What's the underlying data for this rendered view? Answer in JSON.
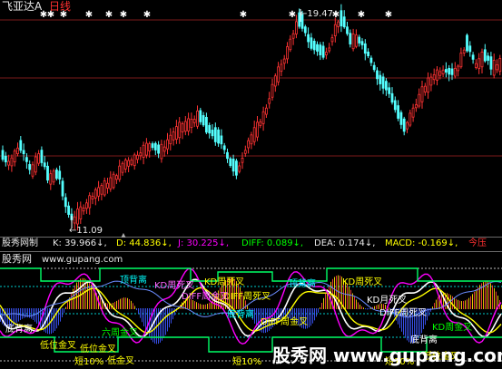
{
  "price_panel": {
    "stock_name": "飞亚达A",
    "period": "日线",
    "high_label": "19.47",
    "low_label": "11.09",
    "colors": {
      "up": "#ff3333",
      "down": "#54ffff",
      "marker": "#ffffff",
      "grid": "#7a1a1a"
    }
  },
  "indicator_bar": {
    "name": "股秀网制",
    "k": "K: 39.966↓,",
    "d": "D: 44.836↓,",
    "j": "J: 30.225↓,",
    "diff": "DIFF: 0.089↓,",
    "dea": "DEA: 0.174↓,",
    "macd": "MACD: -0.169↓,",
    "extra": "今压"
  },
  "indicator_panel": {
    "site_name": "股秀网",
    "url": "www.gupang.com",
    "watermark": "股秀网 www.gupang.com",
    "labels": [
      "顶背离",
      "KD周死叉",
      "KD周死叉",
      "顶背离",
      "KD周死叉",
      "KD月死叉",
      "DIFF周死叉",
      "KD周金叉",
      "DIFF周金叉",
      "底背离",
      "底背离",
      "六周金叉",
      "低位金叉",
      "低位金叉",
      "短10%",
      "低金叉",
      "短10%",
      "短10%",
      "底背离",
      "低位金叉",
      "DIFF周死叉",
      "DIFF周金叉"
    ]
  }
}
